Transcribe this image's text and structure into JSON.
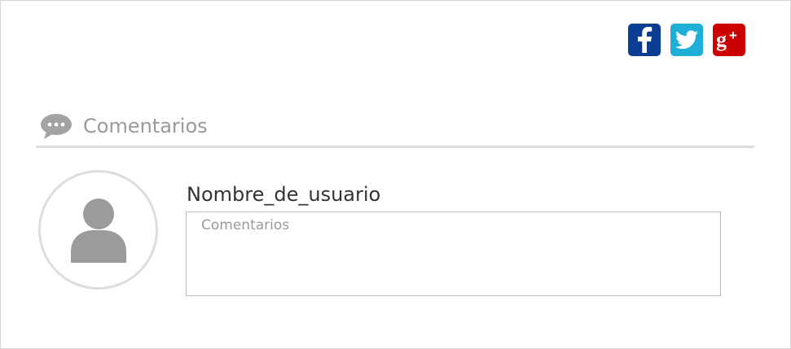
{
  "social": [
    {
      "name": "facebook",
      "icon": "facebook-icon",
      "color": "#0b3d91"
    },
    {
      "name": "twitter",
      "icon": "twitter-icon",
      "color": "#1eaed6"
    },
    {
      "name": "google-plus",
      "icon": "google-plus-icon",
      "color": "#cc0000"
    }
  ],
  "comments_section": {
    "icon": "chat-bubble-icon",
    "title": "Comentarios"
  },
  "user": {
    "avatar_icon": "user-avatar-icon",
    "name": "Nombre_de_usuario"
  },
  "comment_input": {
    "placeholder": "Comentarios",
    "value": ""
  },
  "colors": {
    "divider": "#dddddd",
    "title_gray": "#9a9a9a",
    "avatar_gray": "#9b9b9b"
  }
}
